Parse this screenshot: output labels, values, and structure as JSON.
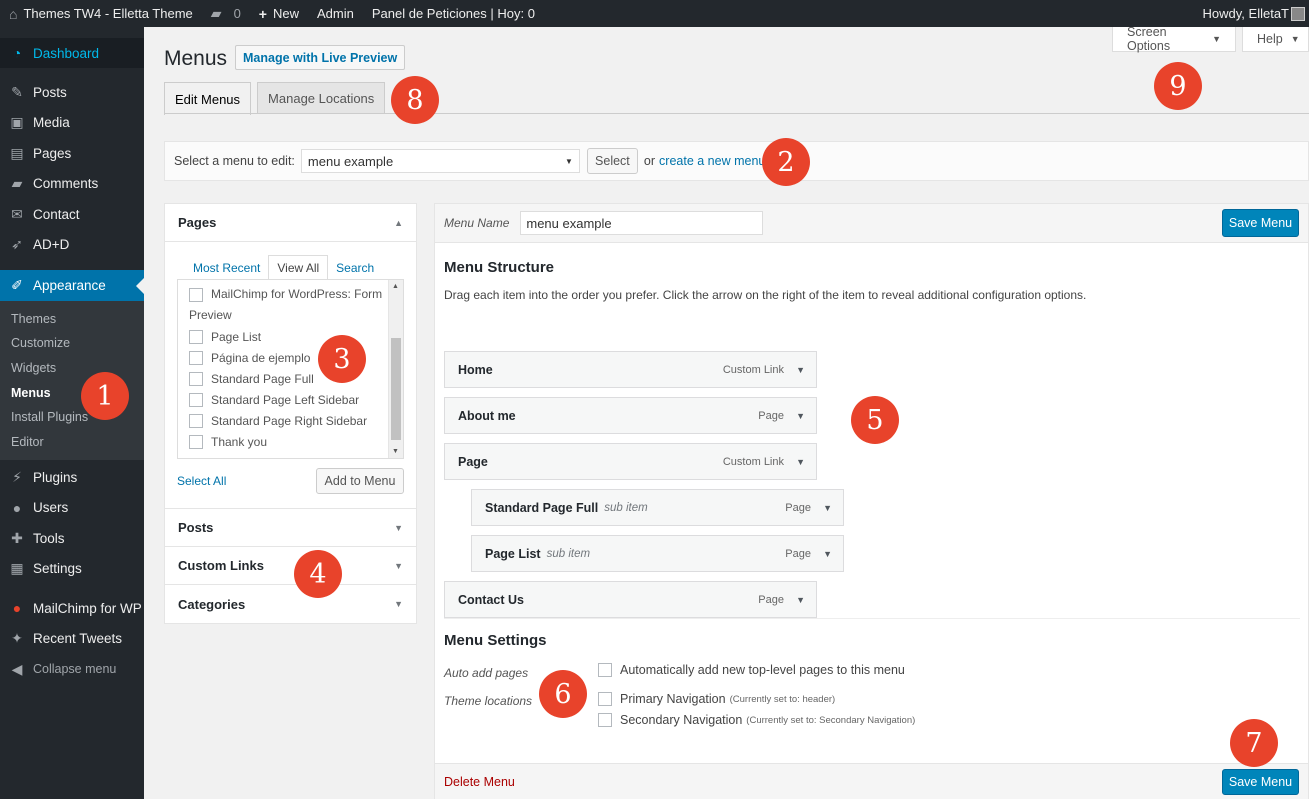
{
  "adminbar": {
    "site_name": "Themes TW4 - Elletta Theme",
    "comments_count": "0",
    "new_label": "New",
    "admin_label": "Admin",
    "panel_label": "Panel de Peticiones | Hoy: 0",
    "howdy": "Howdy, ElletaT"
  },
  "sidebar": {
    "dashboard": "Dashboard",
    "posts": "Posts",
    "media": "Media",
    "pages": "Pages",
    "comments": "Comments",
    "contact": "Contact",
    "add": "AD+D",
    "appearance": "Appearance",
    "sub": [
      "Themes",
      "Customize",
      "Widgets",
      "Menus",
      "Install Plugins",
      "Editor"
    ],
    "plugins": "Plugins",
    "users": "Users",
    "tools": "Tools",
    "settings": "Settings",
    "mailchimp": "MailChimp for WP",
    "tweets": "Recent Tweets",
    "collapse": "Collapse menu"
  },
  "header": {
    "title": "Menus",
    "live_preview": "Manage with Live Preview",
    "screen_options": "Screen Options",
    "help": "Help",
    "tabs": [
      "Edit Menus",
      "Manage Locations"
    ]
  },
  "select_bar": {
    "label": "Select a menu to edit:",
    "value": "menu example",
    "button": "Select",
    "or_text": "or",
    "create_link": "create a new menu."
  },
  "accordion": {
    "pages_title": "Pages",
    "tabs": [
      "Most Recent",
      "View All",
      "Search"
    ],
    "items": [
      "MailChimp for WordPress: Form Preview",
      "Page List",
      "Página de ejemplo",
      "Standard Page Full",
      "Standard Page Left Sidebar",
      "Standard Page Right Sidebar",
      "Thank you"
    ],
    "select_all": "Select All",
    "add_to_menu": "Add to Menu",
    "sections": [
      "Posts",
      "Custom Links",
      "Categories"
    ]
  },
  "menu_editor": {
    "name_label": "Menu Name",
    "name_value": "menu example",
    "save": "Save Menu",
    "structure_title": "Menu Structure",
    "structure_desc": "Drag each item into the order you prefer. Click the arrow on the right of the item to reveal additional configuration options.",
    "items": [
      {
        "title": "Home",
        "sub": "",
        "type": "Custom Link"
      },
      {
        "title": "About me",
        "sub": "",
        "type": "Page"
      },
      {
        "title": "Page",
        "sub": "",
        "type": "Custom Link"
      },
      {
        "title": "Standard Page Full",
        "sub": "sub item",
        "type": "Page"
      },
      {
        "title": "Page List",
        "sub": "sub item",
        "type": "Page"
      },
      {
        "title": "Contact Us",
        "sub": "",
        "type": "Page"
      }
    ],
    "settings_title": "Menu Settings",
    "auto_add_label": "Auto add pages",
    "auto_add_text": "Automatically add new top-level pages to this menu",
    "locations_label": "Theme locations",
    "loc1": "Primary Navigation",
    "loc1_note": "(Currently set to: header)",
    "loc2": "Secondary Navigation",
    "loc2_note": "(Currently set to: Secondary Navigation)",
    "delete": "Delete Menu"
  },
  "badges": [
    "1",
    "2",
    "3",
    "4",
    "5",
    "6",
    "7",
    "8",
    "9"
  ],
  "colors": {
    "admin_bg": "#23282d",
    "accent": "#0073aa",
    "primary_button": "#0085ba",
    "badge": "#e8432b",
    "delete": "#aa0000"
  }
}
